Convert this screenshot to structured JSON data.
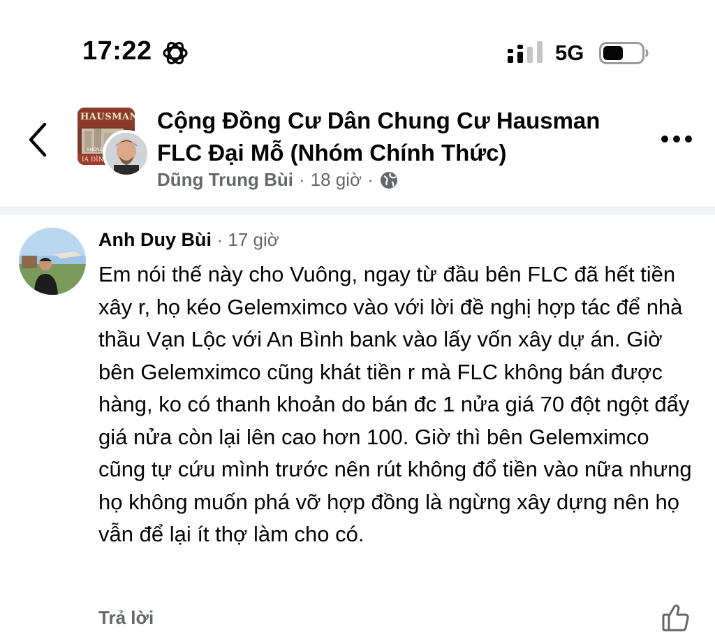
{
  "status_bar": {
    "time": "17:22",
    "network": "5G",
    "icons": [
      "focus-mode-icon",
      "signal-icon",
      "battery-icon"
    ]
  },
  "header": {
    "group_title": "Cộng Đồng Cư Dân Chung Cư Hausman FLC Đại Mỗ (Nhóm Chính Thức)",
    "author": "Dũng Trung Bùi",
    "separator": "·",
    "time": "18 giờ",
    "group_avatar_text": "HAUSMAN",
    "group_avatar_subtext": "KHÔNG",
    "group_avatar_subtext2": "IA ĐÌNH",
    "icons": [
      "back-arrow-icon",
      "globe-icon",
      "more-options-icon"
    ]
  },
  "comment": {
    "author": "Anh Duy Bùi",
    "time": "· 17 giờ",
    "text": "Em nói thế này cho Vuông, ngay từ đầu bên FLC đã hết tiền xây r, họ kéo Gelemximco vào với lời đề nghị hợp tác để nhà thầu Vạn Lộc với An Bình bank vào lấy vốn xây dự án. Giờ bên Gelemximco cũng khát tiền r mà FLC không bán được hàng, ko có thanh khoản do bán đc 1 nửa giá 70 đột ngột đẩy giá nửa còn lại lên cao hơn 100. Giờ thì bên Gelemximco cũng tự cứu mình trước nên rút không đổ tiền vào nữa nhưng họ không muốn phá vỡ hợp đồng là ngừng xây dựng nên họ vẫn để lại ít thợ làm cho có.",
    "reply_label": "Trả lời",
    "icons": [
      "like-icon"
    ]
  },
  "colors": {
    "text_primary": "#050505",
    "text_secondary": "#65676b",
    "divider": "#f0f2f5"
  }
}
